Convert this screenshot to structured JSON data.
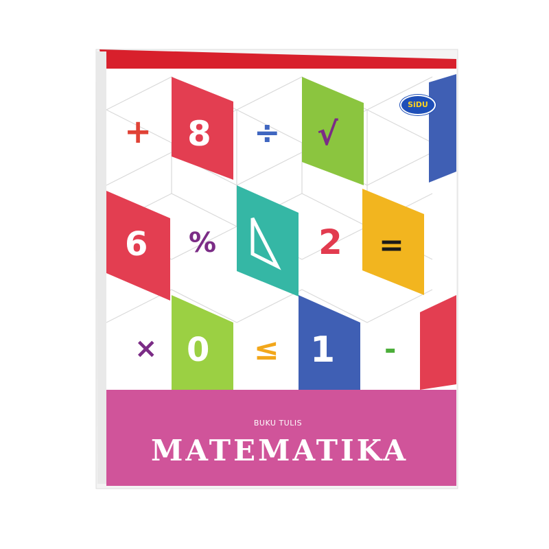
{
  "cover": {
    "brand": "SiDU",
    "subtitle": "BUKU TULIS",
    "title": "MATEMATIKA"
  },
  "symbols": {
    "plus": "+",
    "eight": "8",
    "divide": "÷",
    "sqrt": "√",
    "six": "6",
    "percent": "%",
    "two": "2",
    "equals": "=",
    "times": "×",
    "zero": "0",
    "leq": "≤",
    "one": "1",
    "minus": "-"
  },
  "colors": {
    "spine_red": "#d8202c",
    "band_pink": "#d0549a",
    "tile_red": "#e33e51",
    "tile_green": "#8bc53f",
    "tile_teal": "#35b7a5",
    "tile_yellow": "#f2b51f",
    "tile_blue": "#3f5fb4",
    "tile_lime": "#9bd043"
  }
}
